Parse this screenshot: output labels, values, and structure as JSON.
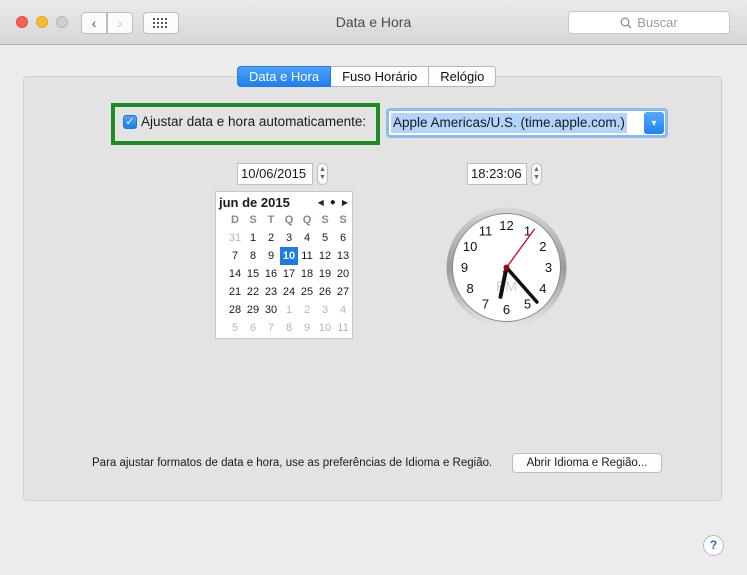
{
  "window": {
    "title": "Data e Hora"
  },
  "toolbar": {
    "back_icon": "‹",
    "forward_icon": "›",
    "search_placeholder": "Buscar"
  },
  "tabs": [
    {
      "label": "Data e Hora",
      "active": true
    },
    {
      "label": "Fuso Horário",
      "active": false
    },
    {
      "label": "Relógio",
      "active": false
    }
  ],
  "auto": {
    "checked": true,
    "label": "Ajustar data e hora automaticamente:",
    "server": "Apple Americas/U.S. (time.apple.com.)"
  },
  "date_field": "10/06/2015",
  "time_field": "18:23:06",
  "calendar": {
    "title": "jun de 2015",
    "days_of_week": [
      "D",
      "S",
      "T",
      "Q",
      "Q",
      "S",
      "S"
    ],
    "weeks": [
      [
        "31",
        "1",
        "2",
        "3",
        "4",
        "5",
        "6"
      ],
      [
        "7",
        "8",
        "9",
        "10",
        "11",
        "12",
        "13"
      ],
      [
        "14",
        "15",
        "16",
        "17",
        "18",
        "19",
        "20"
      ],
      [
        "21",
        "22",
        "23",
        "24",
        "25",
        "26",
        "27"
      ],
      [
        "28",
        "29",
        "30",
        "1",
        "2",
        "3",
        "4"
      ],
      [
        "5",
        "6",
        "7",
        "8",
        "9",
        "10",
        "11"
      ]
    ],
    "other_month_mask": [
      [
        true,
        false,
        false,
        false,
        false,
        false,
        false
      ],
      [
        false,
        false,
        false,
        false,
        false,
        false,
        false
      ],
      [
        false,
        false,
        false,
        false,
        false,
        false,
        false
      ],
      [
        false,
        false,
        false,
        false,
        false,
        false,
        false
      ],
      [
        false,
        false,
        false,
        true,
        true,
        true,
        true
      ],
      [
        true,
        true,
        true,
        true,
        true,
        true,
        true
      ]
    ],
    "selected_day": "10"
  },
  "clock": {
    "numbers": [
      "12",
      "1",
      "2",
      "3",
      "4",
      "5",
      "6",
      "7",
      "8",
      "9",
      "10",
      "11"
    ],
    "period": "PM",
    "hour": 18,
    "minute": 23,
    "second": 6
  },
  "footer": {
    "text": "Para ajustar formatos de data e hora, use as preferências de Idioma e Região.",
    "button": "Abrir Idioma e Região..."
  },
  "help_label": "?",
  "colors": {
    "accent": "#1c7ff3",
    "highlight_box": "#1d8a24",
    "second_hand": "#d0021b"
  }
}
